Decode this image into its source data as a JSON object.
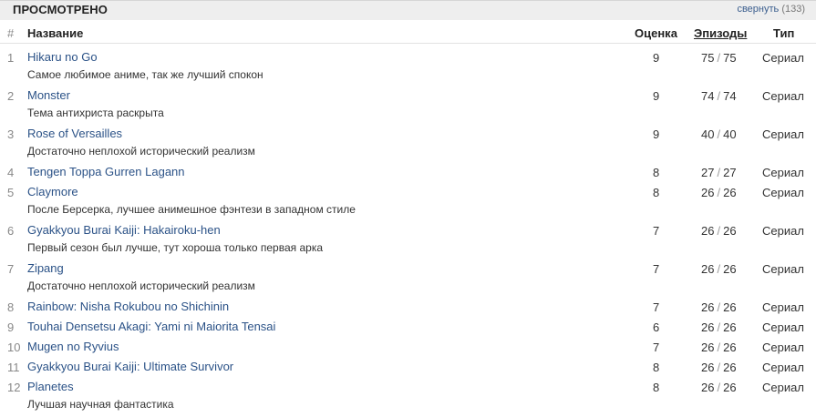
{
  "section": {
    "title": "ПРОСМОТРЕНО",
    "collapse_label": "свернуть",
    "collapse_count": "(133)"
  },
  "columns": {
    "num": "#",
    "title": "Название",
    "score": "Оценка",
    "episodes": "Эпизоды",
    "type": "Тип"
  },
  "rows": [
    {
      "num": "1",
      "title": "Hikaru no Go",
      "comment": "Самое любимое аниме, так же лучший спокон",
      "score": "9",
      "watched": "75",
      "total": "75",
      "type": "Сериал"
    },
    {
      "num": "2",
      "title": "Monster",
      "comment": "Тема антихриста раскрыта",
      "score": "9",
      "watched": "74",
      "total": "74",
      "type": "Сериал"
    },
    {
      "num": "3",
      "title": "Rose of Versailles",
      "comment": "Достаточно неплохой исторический реализм",
      "score": "9",
      "watched": "40",
      "total": "40",
      "type": "Сериал"
    },
    {
      "num": "4",
      "title": "Tengen Toppa Gurren Lagann",
      "comment": "",
      "score": "8",
      "watched": "27",
      "total": "27",
      "type": "Сериал"
    },
    {
      "num": "5",
      "title": "Claymore",
      "comment": "После Берсерка, лучшее анимешное фэнтези в западном стиле",
      "score": "8",
      "watched": "26",
      "total": "26",
      "type": "Сериал"
    },
    {
      "num": "6",
      "title": "Gyakkyou Burai Kaiji: Hakairoku-hen",
      "comment": "Первый сезон был лучше, тут хороша только первая арка",
      "score": "7",
      "watched": "26",
      "total": "26",
      "type": "Сериал"
    },
    {
      "num": "7",
      "title": "Zipang",
      "comment": "Достаточно неплохой исторический реализм",
      "score": "7",
      "watched": "26",
      "total": "26",
      "type": "Сериал"
    },
    {
      "num": "8",
      "title": "Rainbow: Nisha Rokubou no Shichinin",
      "comment": "",
      "score": "7",
      "watched": "26",
      "total": "26",
      "type": "Сериал"
    },
    {
      "num": "9",
      "title": "Touhai Densetsu Akagi: Yami ni Maiorita Tensai",
      "comment": "",
      "score": "6",
      "watched": "26",
      "total": "26",
      "type": "Сериал"
    },
    {
      "num": "10",
      "title": "Mugen no Ryvius",
      "comment": "",
      "score": "7",
      "watched": "26",
      "total": "26",
      "type": "Сериал"
    },
    {
      "num": "11",
      "title": "Gyakkyou Burai Kaiji: Ultimate Survivor",
      "comment": "",
      "score": "8",
      "watched": "26",
      "total": "26",
      "type": "Сериал"
    },
    {
      "num": "12",
      "title": "Planetes",
      "comment": "Лучшая научная фантастика",
      "score": "8",
      "watched": "26",
      "total": "26",
      "type": "Сериал"
    }
  ]
}
